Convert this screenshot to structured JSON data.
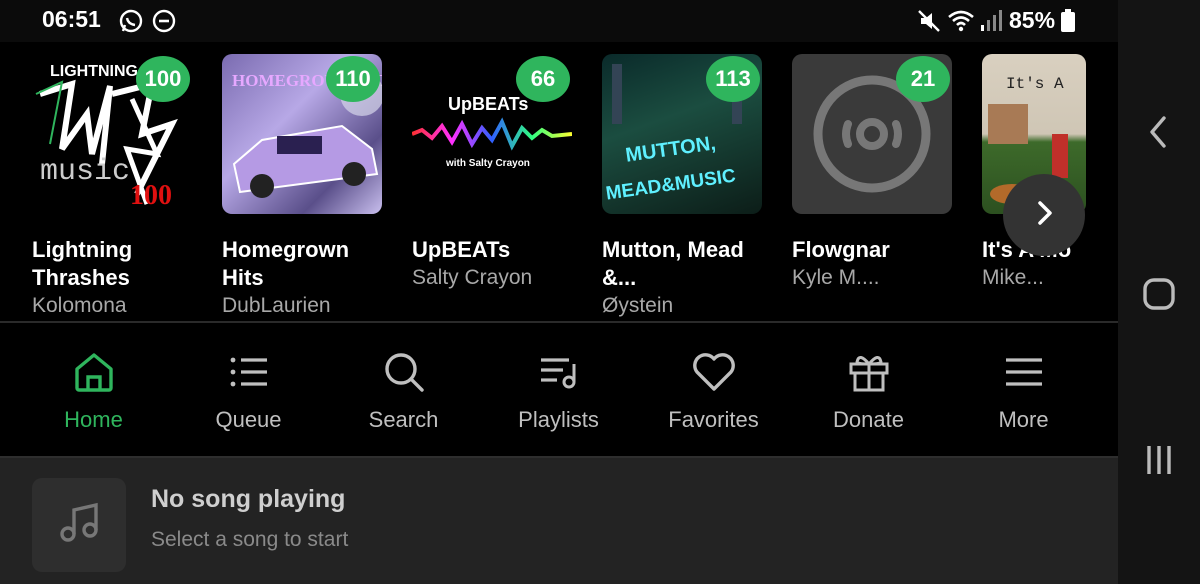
{
  "status_bar": {
    "time": "06:51",
    "battery": "85%",
    "icons": [
      "whatsapp-icon",
      "do-not-disturb-icon",
      "mute-icon",
      "wifi-icon",
      "signal-icon",
      "battery-icon"
    ]
  },
  "albums": [
    {
      "cover_text": "LIGHTNING",
      "badge": "100",
      "title": "Lightning Thrashes",
      "subtitle": "Kolomona"
    },
    {
      "cover_text": "HOMEGROWN HITS",
      "badge": "110",
      "title": "Homegrown Hits",
      "subtitle": "DubLaurien"
    },
    {
      "cover_text": "UpBEATs",
      "cover_sub": "with Salty Crayon",
      "badge": "66",
      "title": "UpBEATs",
      "subtitle": "Salty Crayon"
    },
    {
      "cover_text": "MUTTON, MEAD & MUSIC",
      "badge": "113",
      "title": "Mutton, Mead &...",
      "subtitle": "Øystein"
    },
    {
      "cover_text": "",
      "badge": "21",
      "title": "Flowgnar",
      "subtitle": "Kyle M...."
    },
    {
      "cover_text": "It's A",
      "badge": "",
      "title": "It's A Mo",
      "subtitle": "Mike..."
    }
  ],
  "tabs": [
    {
      "label": "Home",
      "icon": "home-icon",
      "active": true
    },
    {
      "label": "Queue",
      "icon": "queue-icon"
    },
    {
      "label": "Search",
      "icon": "search-icon"
    },
    {
      "label": "Playlists",
      "icon": "playlist-icon"
    },
    {
      "label": "Favorites",
      "icon": "heart-icon"
    },
    {
      "label": "Donate",
      "icon": "gift-icon"
    },
    {
      "label": "More",
      "icon": "menu-icon"
    }
  ],
  "player": {
    "title": "No song playing",
    "subtitle": "Select a song to start"
  },
  "colors": {
    "accent": "#2fb55d",
    "background": "#000000",
    "player_bg": "#232323"
  }
}
